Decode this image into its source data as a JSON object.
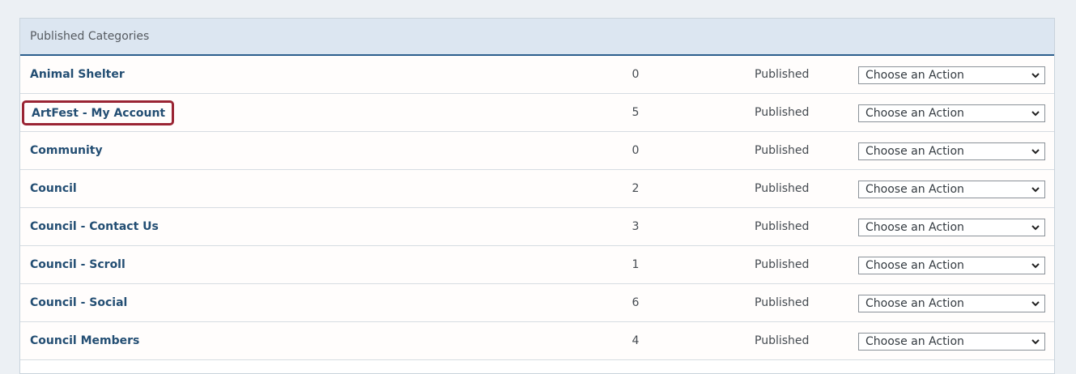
{
  "panel": {
    "title": "Published Categories"
  },
  "rows": [
    {
      "name": "Animal Shelter",
      "count": "0",
      "status": "Published",
      "action": "Choose an Action"
    },
    {
      "name": "ArtFest - My Account",
      "count": "5",
      "status": "Published",
      "action": "Choose an Action"
    },
    {
      "name": "Community",
      "count": "0",
      "status": "Published",
      "action": "Choose an Action"
    },
    {
      "name": "Council",
      "count": "2",
      "status": "Published",
      "action": "Choose an Action"
    },
    {
      "name": "Council - Contact Us",
      "count": "3",
      "status": "Published",
      "action": "Choose an Action"
    },
    {
      "name": "Council - Scroll",
      "count": "1",
      "status": "Published",
      "action": "Choose an Action"
    },
    {
      "name": "Council - Social",
      "count": "6",
      "status": "Published",
      "action": "Choose an Action"
    },
    {
      "name": "Council Members",
      "count": "4",
      "status": "Published",
      "action": "Choose an Action"
    }
  ],
  "colors": {
    "link": "#234e73",
    "header_bg": "#dce6f1",
    "header_border": "#2c5f8d",
    "highlight": "#9a2433"
  }
}
